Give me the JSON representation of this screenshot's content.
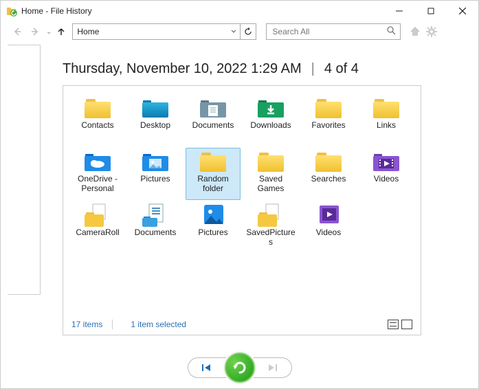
{
  "window": {
    "title": "Home - File History"
  },
  "nav": {
    "address": "Home",
    "search_placeholder": "Search All"
  },
  "header": {
    "timestamp": "Thursday, November 10, 2022 1:29 AM",
    "divider": "|",
    "position": "4 of 4"
  },
  "items": [
    {
      "name": "Contacts",
      "icon": "folder-yellow",
      "selected": false
    },
    {
      "name": "Desktop",
      "icon": "folder-desktop",
      "selected": false
    },
    {
      "name": "Documents",
      "icon": "folder-docs",
      "selected": false
    },
    {
      "name": "Downloads",
      "icon": "folder-download",
      "selected": false
    },
    {
      "name": "Favorites",
      "icon": "folder-yellow",
      "selected": false
    },
    {
      "name": "Links",
      "icon": "folder-yellow",
      "selected": false
    },
    {
      "name": "OneDrive - Personal",
      "icon": "folder-onedrive",
      "selected": false
    },
    {
      "name": "Pictures",
      "icon": "folder-pictures",
      "selected": false
    },
    {
      "name": "Random folder",
      "icon": "folder-yellow",
      "selected": true
    },
    {
      "name": "Saved Games",
      "icon": "folder-yellow",
      "selected": false
    },
    {
      "name": "Searches",
      "icon": "folder-yellow",
      "selected": false
    },
    {
      "name": "Videos",
      "icon": "folder-videos",
      "selected": false
    },
    {
      "name": "CameraRoll",
      "icon": "library-yellow",
      "selected": false
    },
    {
      "name": "Documents",
      "icon": "library-docs",
      "selected": false
    },
    {
      "name": "Pictures",
      "icon": "library-pic",
      "selected": false
    },
    {
      "name": "SavedPictures",
      "icon": "library-yellow",
      "selected": false
    },
    {
      "name": "Videos",
      "icon": "library-video",
      "selected": false
    }
  ],
  "status": {
    "count": "17 items",
    "selection": "1 item selected"
  }
}
